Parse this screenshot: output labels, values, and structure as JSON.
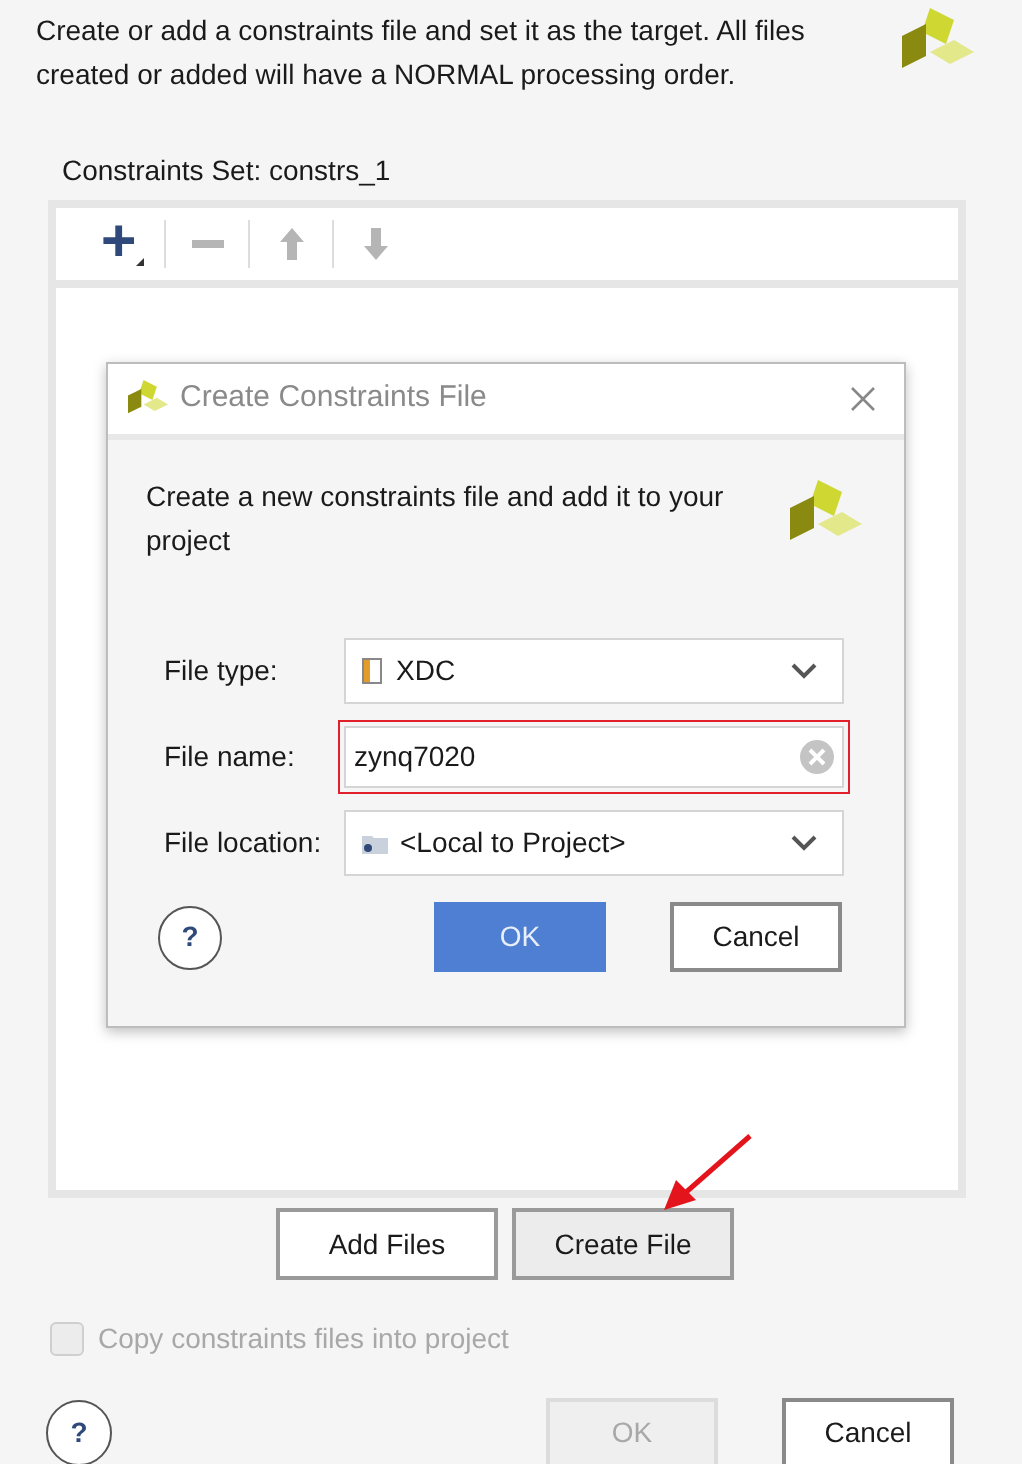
{
  "intro": "Create or add a constraints file and set it as the target. All files created or added will have a NORMAL processing order.",
  "constraints_set_label": "Constraints Set: constrs_1",
  "toolbar": [
    {
      "kind": "add",
      "disabled": false
    },
    {
      "kind": "remove",
      "disabled": true
    },
    {
      "kind": "up",
      "disabled": true
    },
    {
      "kind": "down",
      "disabled": true
    }
  ],
  "dialog": {
    "title": "Create Constraints File",
    "description": "Create a new constraints file and add it to your project",
    "fields": [
      {
        "kind": "select",
        "label": "File type:",
        "value": "XDC"
      },
      {
        "kind": "text",
        "label": "File name:",
        "value": "zynq7020",
        "highlighted": true
      },
      {
        "kind": "select",
        "label": "File location:",
        "value": "<Local to Project>"
      }
    ],
    "help": "?",
    "buttons": [
      {
        "label": "OK",
        "primary": true
      },
      {
        "label": "Cancel",
        "primary": false
      }
    ]
  },
  "file_buttons": [
    {
      "label": "Add Files",
      "pressed": false
    },
    {
      "label": "Create File",
      "pressed": true
    }
  ],
  "copy_option": {
    "label": "Copy constraints files into project",
    "checked": false,
    "disabled": true
  },
  "help": "?",
  "buttons": [
    {
      "label": "OK",
      "disabled": true
    },
    {
      "label": "Cancel",
      "disabled": false
    }
  ]
}
